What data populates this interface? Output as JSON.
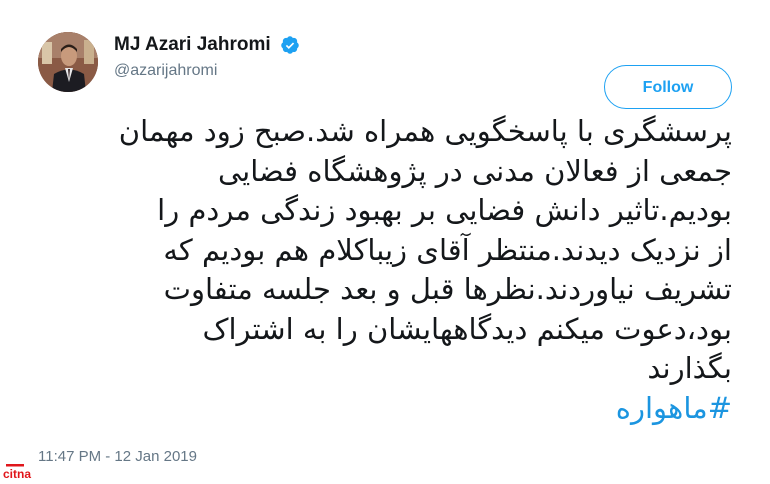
{
  "user": {
    "display_name": "MJ Azari Jahromi",
    "handle": "@azarijahromi",
    "verified": true
  },
  "follow_button": {
    "label": "Follow"
  },
  "tweet": {
    "lines": [
      "پرسشگری با پاسخگویی همراه شد.صبح زود مهمان",
      "جمعی از فعالان مدنی در پژوهشگاه فضایی",
      "بودیم.تاثیر دانش فضایی بر بهبود زندگی مردم را",
      "از نزدیک دیدند.منتظر آقای زیباکلام هم بودیم که",
      "تشریف نیاوردند.نظرها قبل و بعد جلسه متفاوت",
      "بود،دعوت میکنم دیدگاههایشان را به اشتراک",
      "بگذارند"
    ],
    "hashtag": "#ماهواره",
    "timestamp": "11:47 PM - 12 Jan 2019"
  },
  "watermark": {
    "text": "citna"
  },
  "colors": {
    "accent": "#1da1f2",
    "hashtag": "#1b95e0",
    "secondary_text": "#657786",
    "primary_text": "#14171a",
    "watermark": "#e0161b"
  }
}
